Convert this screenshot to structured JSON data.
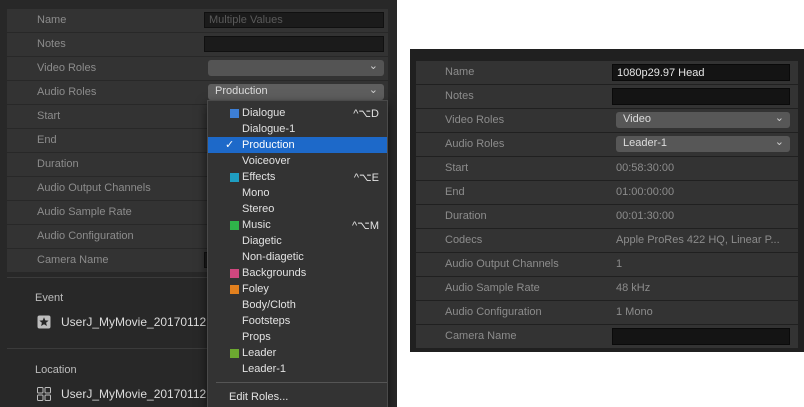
{
  "left": {
    "rows": [
      {
        "label": "Name",
        "kind": "field",
        "placeholder": "Multiple Values"
      },
      {
        "label": "Notes",
        "kind": "field",
        "placeholder": ""
      },
      {
        "label": "Video Roles",
        "kind": "select",
        "value": ""
      },
      {
        "label": "Audio Roles",
        "kind": "select",
        "value": "Production"
      },
      {
        "label": "Start",
        "kind": "text"
      },
      {
        "label": "End",
        "kind": "text"
      },
      {
        "label": "Duration",
        "kind": "text"
      },
      {
        "label": "Audio Output Channels",
        "kind": "text"
      },
      {
        "label": "Audio Sample Rate",
        "kind": "text"
      },
      {
        "label": "Audio Configuration",
        "kind": "text"
      },
      {
        "label": "Camera Name",
        "kind": "text"
      }
    ],
    "event": {
      "title": "Event",
      "value": "UserJ_MyMovie_20170112",
      "icon": "star-icon"
    },
    "location": {
      "title": "Location",
      "value": "UserJ_MyMovie_20170112",
      "icon": "library-icon"
    }
  },
  "menu": {
    "items": [
      {
        "label": "Dialogue",
        "color": "#3d7fd6",
        "shortcut": "^⌥D"
      },
      {
        "label": "Dialogue-1",
        "child": true
      },
      {
        "label": "Production",
        "child": true,
        "selected": true,
        "check": "✓"
      },
      {
        "label": "Voiceover",
        "child": true
      },
      {
        "label": "Effects",
        "color": "#1f9ec2",
        "shortcut": "^⌥E"
      },
      {
        "label": "Mono",
        "child": true
      },
      {
        "label": "Stereo",
        "child": true
      },
      {
        "label": "Music",
        "color": "#2fb44a",
        "shortcut": "^⌥M"
      },
      {
        "label": "Diagetic",
        "child": true
      },
      {
        "label": "Non-diagetic",
        "child": true
      },
      {
        "label": "Backgrounds",
        "color": "#d0477f"
      },
      {
        "label": "Foley",
        "color": "#e2801e"
      },
      {
        "label": "Body/Cloth",
        "child": true
      },
      {
        "label": "Footsteps",
        "child": true
      },
      {
        "label": "Props",
        "child": true
      },
      {
        "label": "Leader",
        "color": "#6ca830"
      },
      {
        "label": "Leader-1",
        "child": true
      }
    ],
    "edit_roles": "Edit Roles..."
  },
  "right": {
    "rows": [
      {
        "label": "Name",
        "kind": "field",
        "value": "1080p29.97 Head"
      },
      {
        "label": "Notes",
        "kind": "field",
        "value": ""
      },
      {
        "label": "Video Roles",
        "kind": "select",
        "value": "Video"
      },
      {
        "label": "Audio Roles",
        "kind": "select",
        "value": "Leader-1"
      },
      {
        "label": "Start",
        "kind": "text",
        "value": "00:58:30:00"
      },
      {
        "label": "End",
        "kind": "text",
        "value": "01:00:00:00"
      },
      {
        "label": "Duration",
        "kind": "text",
        "value": "00:01:30:00"
      },
      {
        "label": "Codecs",
        "kind": "text",
        "value": "Apple ProRes 422 HQ, Linear P..."
      },
      {
        "label": "Audio Output Channels",
        "kind": "text",
        "value": "1"
      },
      {
        "label": "Audio Sample Rate",
        "kind": "text",
        "value": "48 kHz"
      },
      {
        "label": "Audio Configuration",
        "kind": "text",
        "value": "1 Mono"
      },
      {
        "label": "Camera Name",
        "kind": "field",
        "value": ""
      }
    ]
  }
}
